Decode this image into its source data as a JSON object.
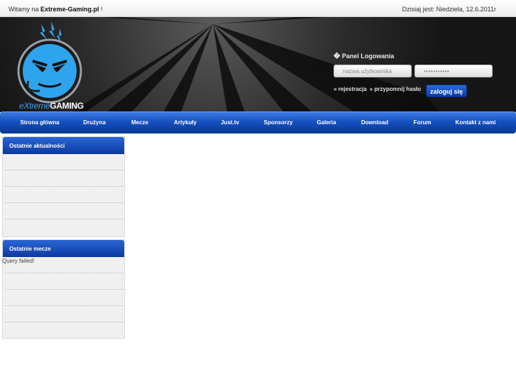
{
  "topbar": {
    "welcome_prefix": "Witamy na ",
    "site_name": "Extreme-Gaming.pl",
    "welcome_suffix": " !",
    "date_text": "Dzisiaj jest: Niedziela, 12.6.2011r"
  },
  "header": {
    "logo_text_prefix": "eXtreme",
    "logo_text_suffix": "GAMING"
  },
  "login": {
    "title": "� Panel Logowania",
    "username_placeholder": "nazwa użytkownika",
    "password_value": "•••••••••••",
    "register_link": "» rejestracja",
    "remind_link": "» przypomnij hasło",
    "submit_label": "zaloguj się"
  },
  "nav": {
    "items": [
      "Strona główna",
      "Drużyna",
      "Mecze",
      "Artykuły",
      "Just.tv",
      "Sponsorzy",
      "Galeria",
      "Download",
      "Forum",
      "Kontakt z nami"
    ]
  },
  "sidebar": {
    "news_title": "Ostatnie aktualności",
    "matches_title": "Ostatnie mecze",
    "matches_error": "Query failed!"
  },
  "colors": {
    "accent_blue": "#1550c0",
    "header_bg": "#161616",
    "logo_blue": "#3aa0e8"
  }
}
